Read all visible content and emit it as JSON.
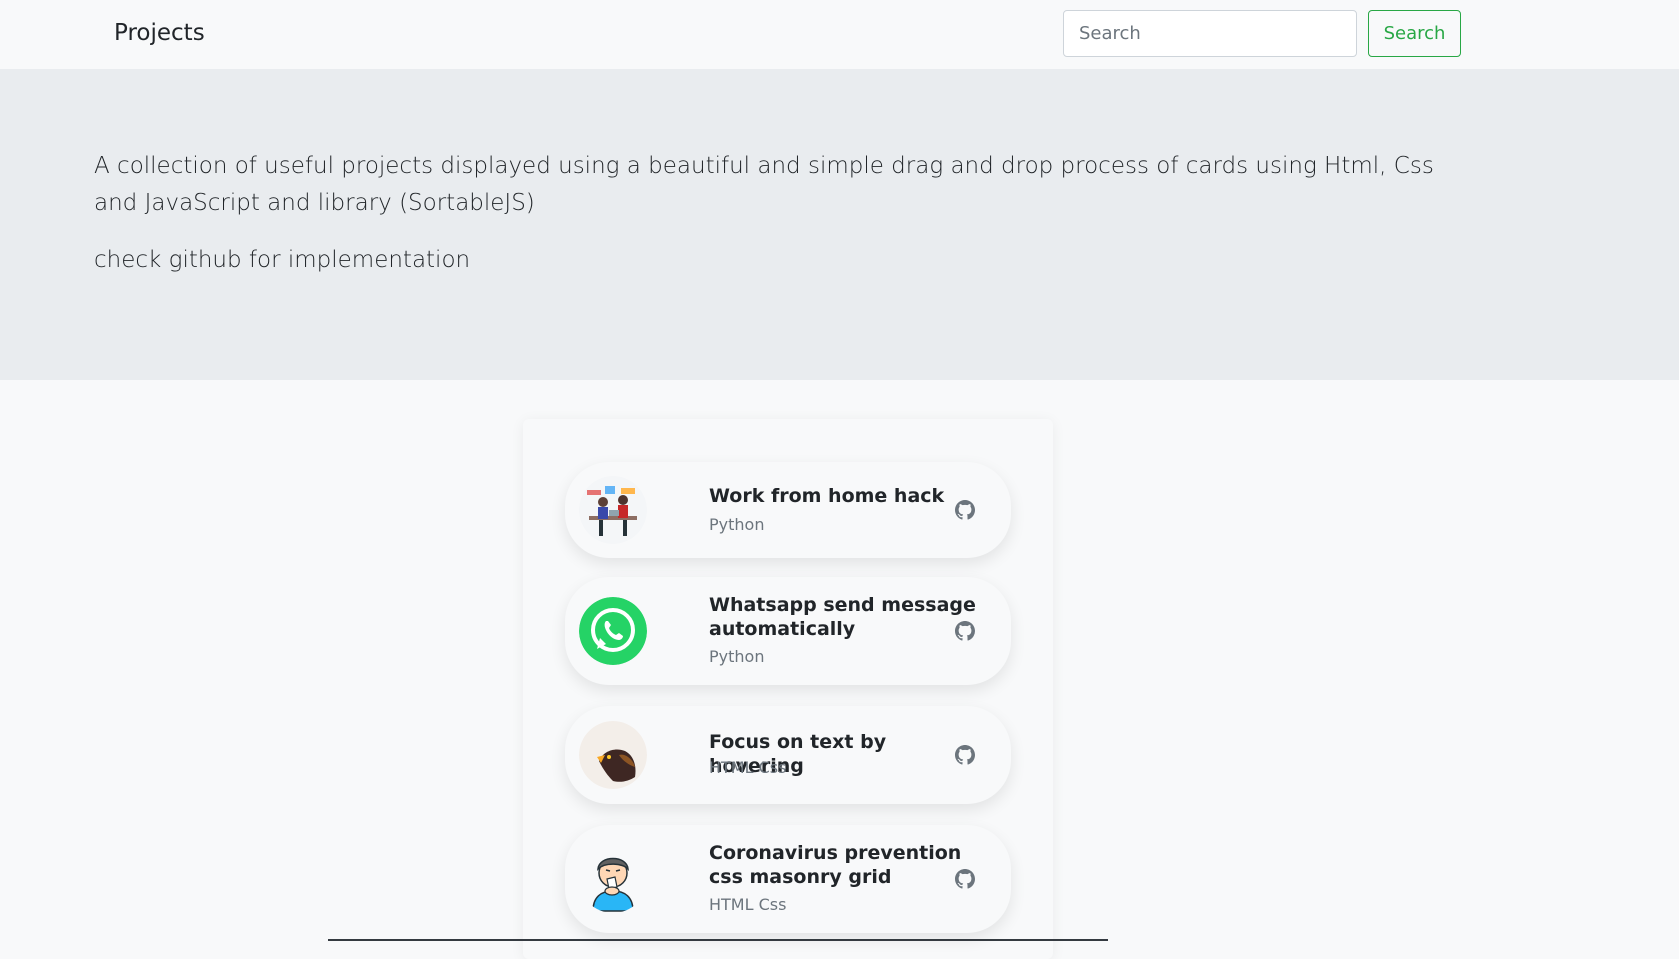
{
  "navbar": {
    "brand": "Projects",
    "search_placeholder": "Search",
    "search_button": "Search"
  },
  "hero": {
    "lead": "A collection of useful projects displayed using a beautiful and simple drag and drop process of cards using Html, Css and JavaScript and library (SortableJS)",
    "sub": "check github for implementation"
  },
  "projects": [
    {
      "title": "Work from home hack",
      "tech": "Python",
      "icon": "work-from-home-illustration"
    },
    {
      "title": "Whatsapp send message automatically",
      "tech": "Python",
      "icon": "whatsapp-logo"
    },
    {
      "title": "Focus on text by hovering",
      "tech": "HTML Css",
      "icon": "eagle-image"
    },
    {
      "title": "Coronavirus prevention css masonry grid",
      "tech": "HTML Css",
      "icon": "sneezing-person-illustration"
    }
  ],
  "colors": {
    "accent_green": "#28a745",
    "whatsapp_green": "#25d366",
    "jumbotron_bg": "#e9ecef",
    "page_bg": "#f8f9fa"
  }
}
